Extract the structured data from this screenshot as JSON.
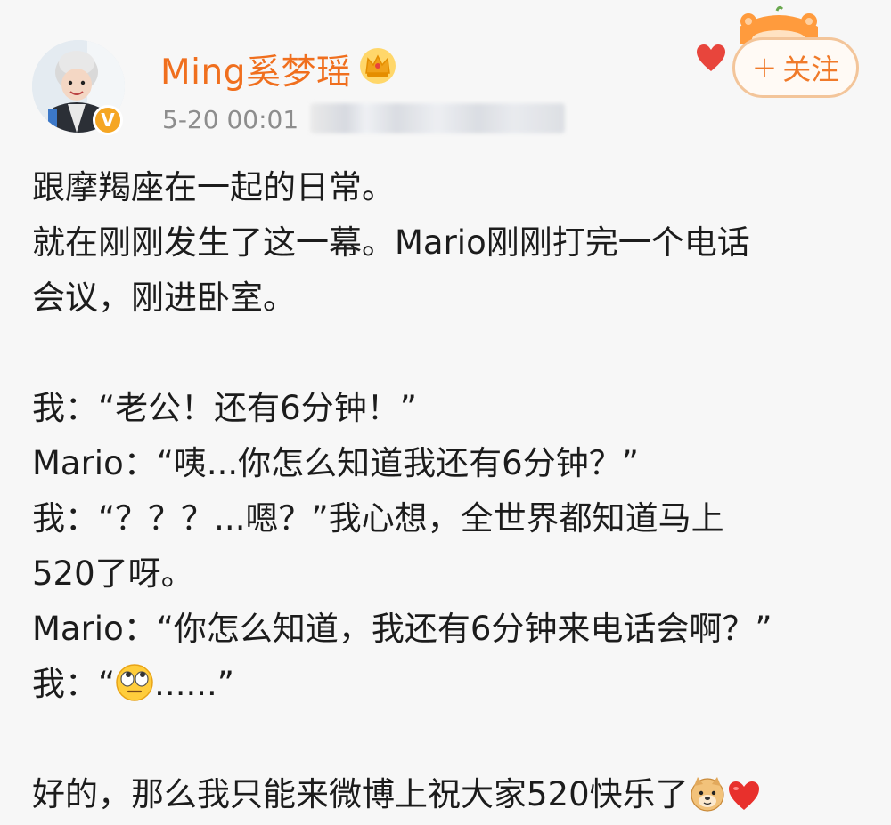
{
  "post": {
    "author": {
      "name": "Ming奚梦瑶",
      "avatar_icon": "avatar-icon",
      "verified_icon": "verified-v-icon",
      "crown_icon": "crown-icon"
    },
    "timestamp": "5-20 00:01",
    "follow_button": {
      "plus": "+",
      "label": "关注"
    },
    "colors": {
      "username": "#f06f1e",
      "follow_border": "#f3c59a",
      "follow_text": "#f07a2a",
      "verified": "#f5a623"
    },
    "lines": [
      "跟摩羯座在一起的日常。",
      "就在刚刚发生了这一幕。Mario刚刚打完一个电话",
      "会议，刚进卧室。",
      "",
      "我：“老公！还有6分钟！”",
      "Mario：“咦...你怎么知道我还有6分钟？”",
      "我：“？？？...嗯？”我心想，全世界都知道马上",
      "520了呀。",
      "Mario：“你怎么知道，我还有6分钟来电话会啊？”"
    ],
    "line_emoji": {
      "prefix": "我：“",
      "emoji": "eye-roll-emoji",
      "suffix": "......”"
    },
    "final_line": {
      "text": "好的，那么我只能来微博上祝大家520快乐了",
      "emojis": [
        "doge-emoji",
        "red-heart-emoji"
      ]
    }
  }
}
